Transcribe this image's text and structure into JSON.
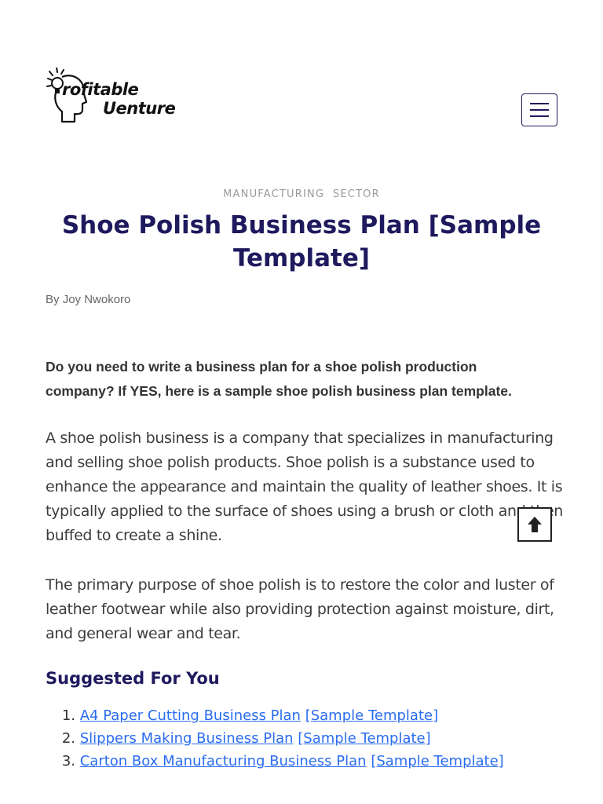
{
  "header": {
    "logo": {
      "line1": "rofitable",
      "line2": "Uenture"
    },
    "menu_icon": "hamburger-menu-icon"
  },
  "article": {
    "category": "MANUFACTURING  SECTOR",
    "title": "Shoe Polish Business Plan [Sample Template]",
    "byline_prefix": "By ",
    "author": "Joy Nwokoro",
    "intro": "Do you need to write a business plan for a shoe polish production company? If YES, here is a sample shoe polish business plan template.",
    "paragraphs": [
      "A shoe polish business is a company that specializes in manufacturing and selling shoe polish products. Shoe polish is a substance used to enhance the appearance and maintain the quality of leather shoes. It is typically applied to the surface of shoes using a brush or cloth and then buffed to create a shine.",
      "The primary purpose of shoe polish is to restore the color and luster of leather footwear while also providing protection against moisture, dirt, and general wear and tear."
    ]
  },
  "suggested": {
    "heading": "Suggested For You",
    "items": [
      {
        "num": "1.",
        "link": "A4 Paper Cutting Business Plan",
        "suffix": "[Sample Template]"
      },
      {
        "num": "2.",
        "link": "Slippers Making Business Plan",
        "suffix": "[Sample Template]"
      },
      {
        "num": "3.",
        "link": "Carton Box Manufacturing Business Plan",
        "suffix": "[Sample Template]"
      }
    ]
  },
  "scroll_top_icon": "arrow-up-icon",
  "colors": {
    "title": "#1f1a5e",
    "link": "#2a6cf0",
    "category": "#9a9a9a"
  }
}
